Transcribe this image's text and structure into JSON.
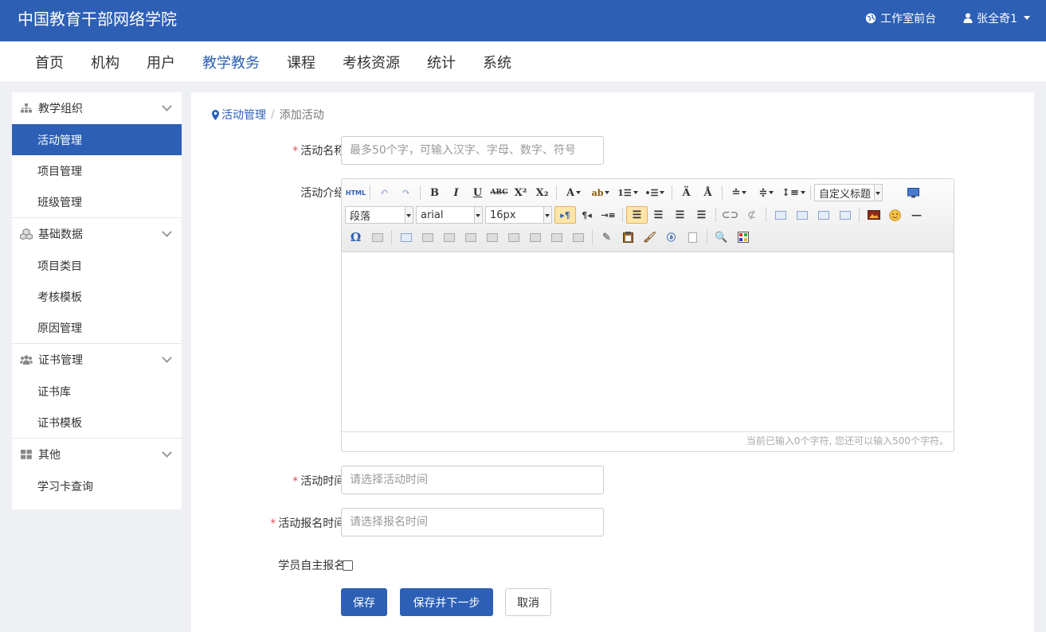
{
  "header": {
    "brand": "中国教育干部网络学院",
    "frontend_link": "工作室前台",
    "user": "张全奇1"
  },
  "nav": [
    "首页",
    "机构",
    "用户",
    "教学教务",
    "课程",
    "考核资源",
    "统计",
    "系统"
  ],
  "nav_active": "教学教务",
  "sidebar": {
    "groups": [
      {
        "title": "教学组织",
        "icon": "sitemap-icon",
        "items": [
          "活动管理",
          "项目管理",
          "班级管理"
        ]
      },
      {
        "title": "基础数据",
        "icon": "cubes-icon",
        "items": [
          "项目类目",
          "考核模板",
          "原因管理"
        ]
      },
      {
        "title": "证书管理",
        "icon": "users-icon",
        "items": [
          "证书库",
          "证书模板"
        ]
      },
      {
        "title": "其他",
        "icon": "th-large-icon",
        "items": [
          "学习卡查询"
        ]
      }
    ],
    "active_item": "活动管理"
  },
  "breadcrumb": {
    "parent": "活动管理",
    "separator": "/",
    "current": "添加活动"
  },
  "form": {
    "name_label": "活动名称:",
    "name_placeholder": "最多50个字，可输入汉字、字母、数字、符号",
    "intro_label": "活动介绍:",
    "editor": {
      "paragraph_select": "段落",
      "font_select": "arial",
      "size_select": "16px",
      "custom_title_select": "自定义标题",
      "counter": "当前已输入0个字符, 您还可以输入500个字符。"
    },
    "time_label": "活动时间:",
    "time_placeholder": "请选择活动时间",
    "signup_time_label": "活动报名时间:",
    "signup_time_placeholder": "请选择报名时间",
    "self_signup_label": "学员自主报名:",
    "self_signup_checked": false
  },
  "buttons": {
    "save": "保存",
    "save_next": "保存并下一步",
    "cancel": "取消"
  },
  "colors": {
    "primary": "#2d5fb5",
    "required": "#d9534f"
  }
}
